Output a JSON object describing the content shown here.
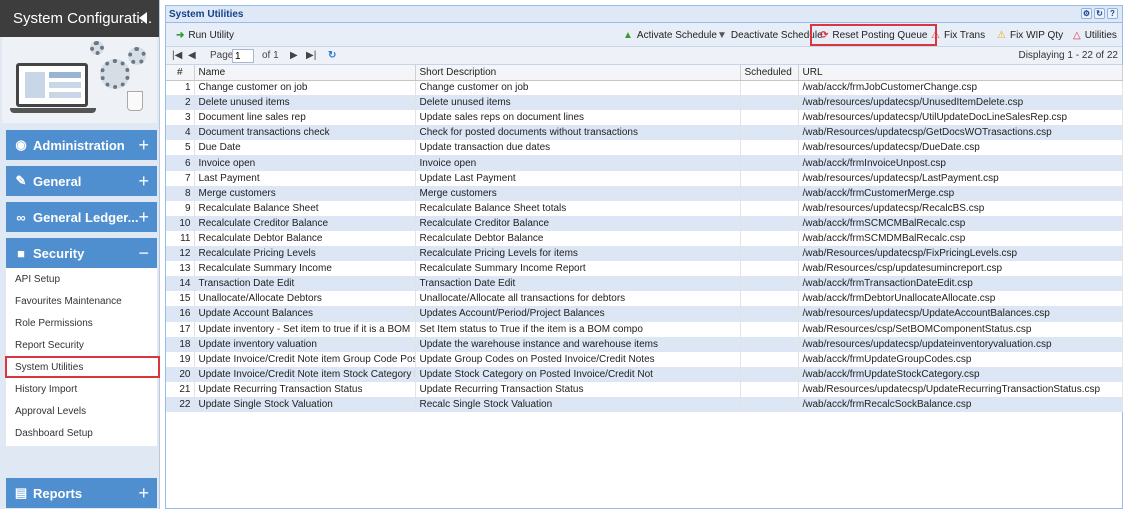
{
  "sidebar": {
    "title": "System Configurati...",
    "sections": {
      "administration": "Administration",
      "general": "General",
      "general_ledger": "General Ledger...",
      "security": "Security",
      "reports": "Reports"
    },
    "security_items": [
      "API Setup",
      "Favourites Maintenance",
      "Role Permissions",
      "Report Security",
      "System Utilities",
      "History Import",
      "Approval Levels",
      "Dashboard Setup"
    ]
  },
  "panel": {
    "title": "System Utilities"
  },
  "toolbar": {
    "run_utility": "Run Utility",
    "activate_schedule": "Activate Schedule",
    "deactivate_schedule": "Deactivate Schedule",
    "reset_posting_queue": "Reset Posting Queue",
    "fix_trans": "Fix Trans",
    "fix_wip_qty": "Fix WIP Qty",
    "utilities": "Utilities"
  },
  "pager": {
    "page_label": "Page",
    "page_value": "1",
    "of_label": "of 1",
    "displaying": "Displaying 1 - 22 of 22"
  },
  "grid": {
    "headers": {
      "num": "#",
      "name": "Name",
      "desc": "Short Description",
      "scheduled": "Scheduled",
      "url": "URL"
    },
    "rows": [
      {
        "n": "1",
        "name": "Change customer on job",
        "desc": "Change customer on job",
        "url": "/wab/acck/frmJobCustomerChange.csp"
      },
      {
        "n": "2",
        "name": "Delete unused items",
        "desc": "Delete unused items",
        "url": "/wab/resources/updatecsp/UnusedItemDelete.csp"
      },
      {
        "n": "3",
        "name": "Document line sales rep",
        "desc": "Update sales reps on document lines",
        "url": "/wab/resources/updatecsp/UtilUpdateDocLineSalesRep.csp"
      },
      {
        "n": "4",
        "name": "Document transactions check",
        "desc": "Check for posted documents without transactions",
        "url": "/wab/Resources/updatecsp/GetDocsWOTrasactions.csp"
      },
      {
        "n": "5",
        "name": "Due Date",
        "desc": "Update transaction due dates",
        "url": "/wab/resources/updatecsp/DueDate.csp"
      },
      {
        "n": "6",
        "name": "Invoice open",
        "desc": "Invoice open",
        "url": "/wab/acck/frmInvoiceUnpost.csp"
      },
      {
        "n": "7",
        "name": "Last Payment",
        "desc": "Update Last Payment",
        "url": "/wab/resources/updatecsp/LastPayment.csp"
      },
      {
        "n": "8",
        "name": "Merge customers",
        "desc": "Merge customers",
        "url": "/wab/acck/frmCustomerMerge.csp"
      },
      {
        "n": "9",
        "name": "Recalculate Balance Sheet",
        "desc": "Recalculate Balance Sheet totals",
        "url": "/wab/resources/updatecsp/RecalcBS.csp"
      },
      {
        "n": "10",
        "name": "Recalculate Creditor Balance",
        "desc": "Recalculate Creditor Balance",
        "url": "/wab/acck/frmSCMCMBalRecalc.csp"
      },
      {
        "n": "11",
        "name": "Recalculate Debtor Balance",
        "desc": "Recalculate Debtor Balance",
        "url": "/wab/acck/frmSCMDMBalRecalc.csp"
      },
      {
        "n": "12",
        "name": "Recalculate Pricing Levels",
        "desc": "Recalculate Pricing Levels for items",
        "url": "/wab/Resources/updatecsp/FixPricingLevels.csp"
      },
      {
        "n": "13",
        "name": "Recalculate Summary Income",
        "desc": "Recalculate Summary Income Report",
        "url": "/wab/Resources/csp/updatesumincreport.csp"
      },
      {
        "n": "14",
        "name": "Transaction Date Edit",
        "desc": "Transaction Date Edit",
        "url": "/wab/acck/frmTransactionDateEdit.csp"
      },
      {
        "n": "15",
        "name": "Unallocate/Allocate Debtors",
        "desc": "Unallocate/Allocate all transactions for debtors",
        "url": "/wab/acck/frmDebtorUnallocateAllocate.csp"
      },
      {
        "n": "16",
        "name": "Update Account Balances",
        "desc": "Updates Account/Period/Project Balances",
        "url": "/wab/resources/updatecsp/UpdateAccountBalances.csp"
      },
      {
        "n": "17",
        "name": "Update inventory - Set item to true if it is a BOM",
        "desc": "Set Item status to True if the item is a BOM compo",
        "url": "/wab/Resources/csp/SetBOMComponentStatus.csp"
      },
      {
        "n": "18",
        "name": "Update inventory valuation",
        "desc": "Update the warehouse instance and warehouse items",
        "url": "/wab/resources/updatecsp/updateinventoryvaluation.csp"
      },
      {
        "n": "19",
        "name": "Update Invoice/Credit Note item Group Code Posting",
        "desc": "Update Group Codes on Posted Invoice/Credit Notes",
        "url": "/wab/acck/frmUpdateGroupCodes.csp"
      },
      {
        "n": "20",
        "name": "Update Invoice/Credit Note item Stock Category Pos",
        "desc": "Update Stock Category on Posted Invoice/Credit Not",
        "url": "/wab/acck/frmUpdateStockCategory.csp"
      },
      {
        "n": "21",
        "name": "Update Recurring Transaction Status",
        "desc": "Update Recurring Transaction Status",
        "url": "/wab/Resources/updatecsp/UpdateRecurringTransactionStatus.csp"
      },
      {
        "n": "22",
        "name": "Update Single Stock Valuation",
        "desc": "Recalc Single Stock Valuation",
        "url": "/wab/acck/frmRecalcSockBalance.csp"
      }
    ]
  },
  "colors": {
    "nav_blue": "#4f8fcf",
    "highlight_red": "#d9363e",
    "row_alt": "#dce6f4",
    "header_dark": "#3d3d3d"
  }
}
